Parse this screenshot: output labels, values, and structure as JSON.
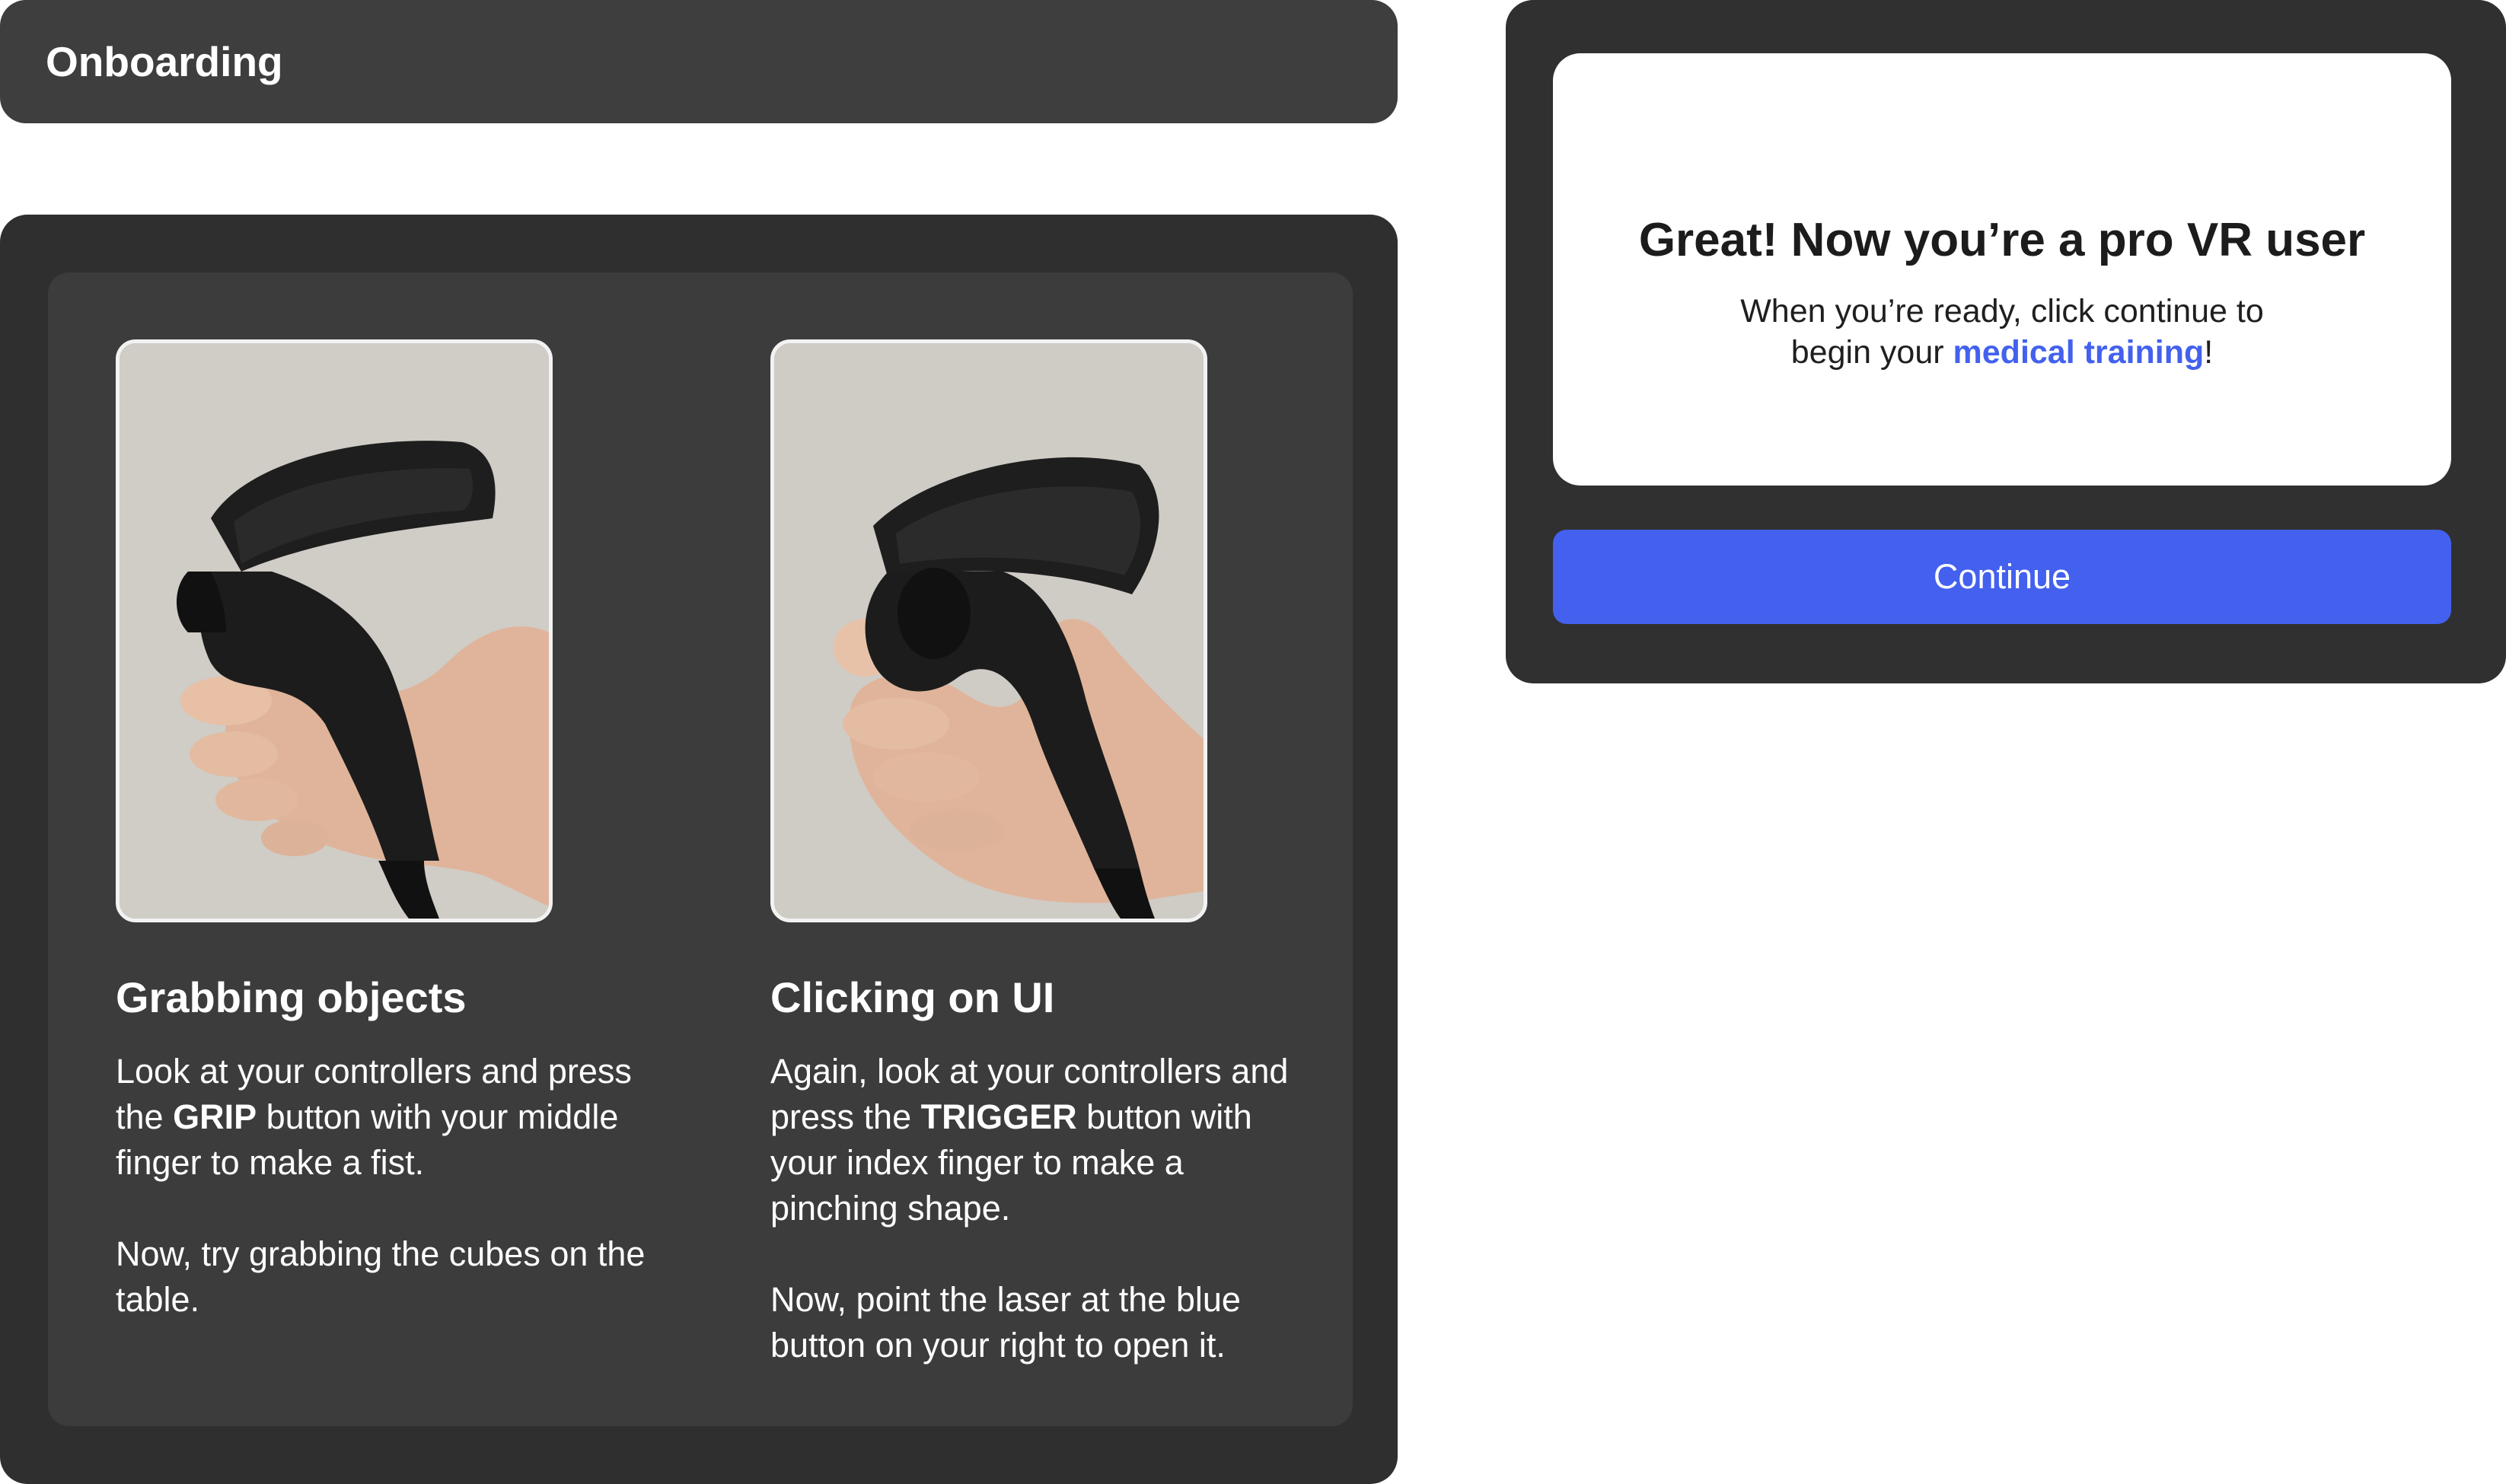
{
  "header": {
    "title": "Onboarding"
  },
  "cards": [
    {
      "title": "Grabbing objects",
      "body": {
        "p1_prefix": "Look at your controllers and press the ",
        "p1_bold": "GRIP",
        "p1_suffix": " button with your middle finger to make a fist.",
        "p2": "Now, try grabbing the cubes on the table."
      }
    },
    {
      "title": "Clicking on UI",
      "body": {
        "p1_prefix": "Again, look at your controllers and press the ",
        "p1_bold": "TRIGGER",
        "p1_suffix": " button with your index finger to make a pinching shape.",
        "p2": "Now, point the laser at the blue button on your right to open it."
      }
    }
  ],
  "dialog": {
    "title": "Great! Now you’re a pro VR user",
    "line1": "When you’re ready, click continue to",
    "line2_prefix": "begin your ",
    "line2_highlight": "medical training",
    "line2_suffix": "!",
    "button_label": "Continue"
  },
  "colors": {
    "accent": "#4361ee",
    "panel_dark": "#2f2f2f",
    "panel_mid": "#3c3c3c",
    "header_bg": "#3e3e3e"
  }
}
